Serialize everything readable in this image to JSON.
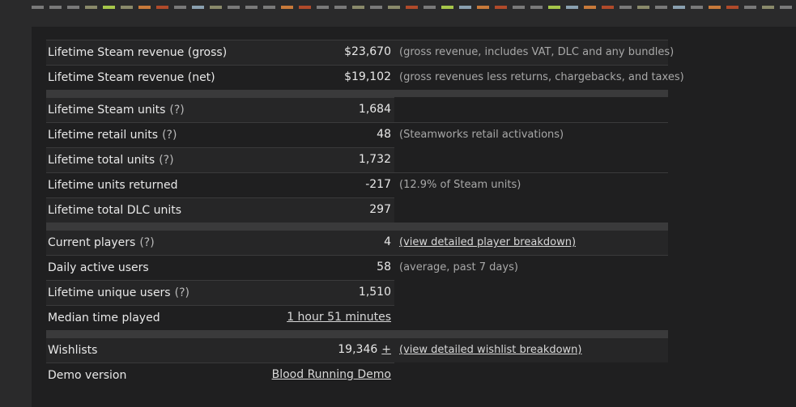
{
  "colorbar": [
    "#7a7a7a",
    "#7a7a7a",
    "#7a7a7a",
    "#8a8a6a",
    "#a6c64a",
    "#8a8a6a",
    "#c87a3a",
    "#b04a2a",
    "#7a7a7a",
    "#8aa0b0",
    "#8a8a6a",
    "#7a7a7a",
    "#7a7a7a",
    "#7a7a7a",
    "#c87a3a",
    "#b04a2a",
    "#7a7a7a",
    "#7a7a7a",
    "#8a8a6a",
    "#7a7a7a",
    "#8a8a6a",
    "#b04a2a",
    "#7a7a7a",
    "#a6c64a",
    "#8aa0b0",
    "#c87a3a",
    "#b04a2a",
    "#7a7a7a",
    "#7a7a7a",
    "#a6c64a",
    "#8aa0b0",
    "#c87a3a",
    "#b04a2a",
    "#7a7a7a",
    "#8a8a6a",
    "#7a7a7a",
    "#8aa0b0",
    "#7a7a7a",
    "#c87a3a",
    "#b04a2a",
    "#7a7a7a",
    "#8a8a6a",
    "#7a7a7a"
  ],
  "groups": [
    {
      "rows": [
        {
          "label": "Lifetime Steam revenue (gross)",
          "help": "",
          "value": "$23,670",
          "note": "(gross revenue, includes VAT, DLC and any bundles)",
          "link": ""
        },
        {
          "label": "Lifetime Steam revenue (net)",
          "help": "",
          "value": "$19,102",
          "note": "(gross revenues less returns, chargebacks, and taxes)",
          "link": ""
        }
      ]
    },
    {
      "rows": [
        {
          "label": "Lifetime Steam units",
          "help": "(?)",
          "value": "1,684",
          "note": "",
          "link": ""
        },
        {
          "label": "Lifetime retail units",
          "help": "(?)",
          "value": "48",
          "note": "(Steamworks retail activations)",
          "link": ""
        },
        {
          "label": "Lifetime total units",
          "help": "(?)",
          "value": "1,732",
          "note": "",
          "link": ""
        },
        {
          "label": "Lifetime units returned",
          "help": "",
          "value": "-217",
          "note": "(12.9% of Steam units)",
          "link": ""
        },
        {
          "label": "Lifetime total DLC units",
          "help": "",
          "value": "297",
          "note": "",
          "link": ""
        }
      ]
    },
    {
      "rows": [
        {
          "label": "Current players",
          "help": "(?)",
          "value": "4",
          "note": "",
          "link": "(view detailed player breakdown)"
        },
        {
          "label": "Daily active users",
          "help": "",
          "value": "58",
          "note": "(average, past 7 days)",
          "link": ""
        },
        {
          "label": "Lifetime unique users",
          "help": "(?)",
          "value": "1,510",
          "note": "",
          "link": ""
        },
        {
          "label": "Median time played",
          "help": "",
          "value": "",
          "value_link": "1 hour 51 minutes",
          "note": "",
          "link": ""
        }
      ]
    },
    {
      "rows": [
        {
          "label": "Wishlists",
          "help": "",
          "value": "19,346",
          "plus": "+",
          "note": "",
          "link": "(view detailed wishlist breakdown)"
        },
        {
          "label": "Demo version",
          "help": "",
          "value": "",
          "value_link": "Blood Running Demo",
          "note": "",
          "link": ""
        }
      ]
    }
  ]
}
